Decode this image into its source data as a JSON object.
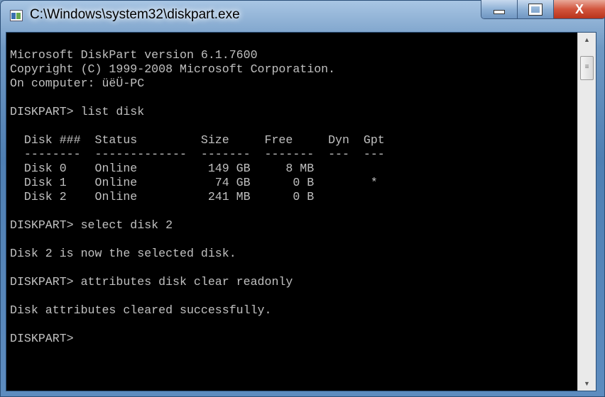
{
  "window": {
    "title": "C:\\Windows\\system32\\diskpart.exe",
    "minimize": "minimize",
    "maximize": "maximize",
    "close": "X"
  },
  "console": {
    "lines": [
      "",
      "Microsoft DiskPart version 6.1.7600",
      "Copyright (C) 1999-2008 Microsoft Corporation.",
      "On computer: üëÜ-PC",
      "",
      "DISKPART> list disk",
      "",
      "  Disk ###  Status         Size     Free     Dyn  Gpt",
      "  --------  -------------  -------  -------  ---  ---",
      "  Disk 0    Online          149 GB     8 MB",
      "  Disk 1    Online           74 GB      0 B        *",
      "  Disk 2    Online          241 MB      0 B",
      "",
      "DISKPART> select disk 2",
      "",
      "Disk 2 is now the selected disk.",
      "",
      "DISKPART> attributes disk clear readonly",
      "",
      "Disk attributes cleared successfully.",
      "",
      "DISKPART> "
    ]
  },
  "scrollbar": {
    "up": "▲",
    "down": "▼",
    "grip": "≡"
  }
}
